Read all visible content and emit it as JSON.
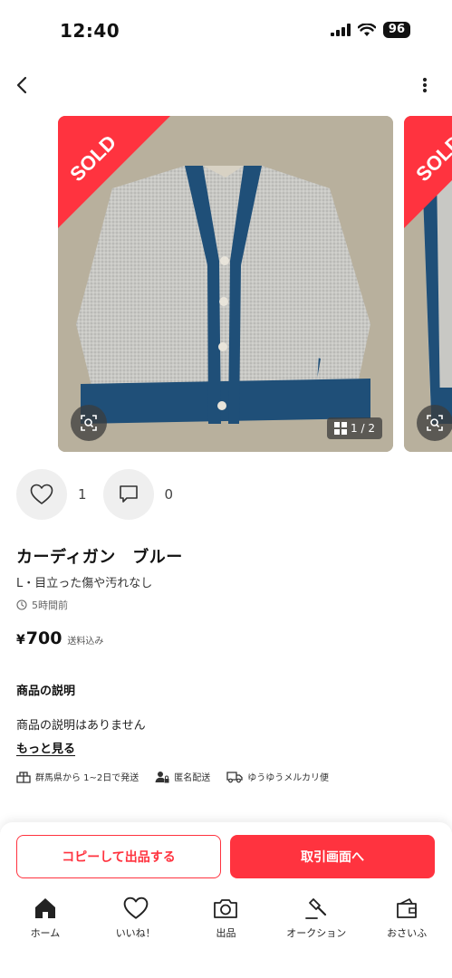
{
  "status": {
    "time": "12:40",
    "battery": "96"
  },
  "item": {
    "sold_label": "SOLD",
    "image_counter": "1 / 2",
    "likes": "1",
    "comments": "0",
    "title": "カーディガン　ブルー",
    "subtitle": "L・目立った傷や汚れなし",
    "posted": "5時間前",
    "price_symbol": "¥",
    "price": "700",
    "shipping_note": "送料込み"
  },
  "description": {
    "heading": "商品の説明",
    "body": "商品の説明はありません",
    "more_label": "もっと見る"
  },
  "shipping": {
    "origin": "群馬県から 1~2日で発送",
    "anonymous": "匿名配送",
    "method": "ゆうゆうメルカリ便"
  },
  "actions": {
    "copy_label": "コピーして出品する",
    "trade_label": "取引画面へ"
  },
  "tabs": [
    {
      "label": "ホーム",
      "icon": "home-icon"
    },
    {
      "label": "いいね！",
      "icon": "heart-icon"
    },
    {
      "label": "出品",
      "icon": "camera-icon"
    },
    {
      "label": "オークション",
      "icon": "gavel-icon"
    },
    {
      "label": "おさいふ",
      "icon": "wallet-icon"
    }
  ],
  "colors": {
    "accent": "#ff333f",
    "cardigan_trim": "#1f4f78",
    "cardigan_body": "#c7c7c3"
  }
}
